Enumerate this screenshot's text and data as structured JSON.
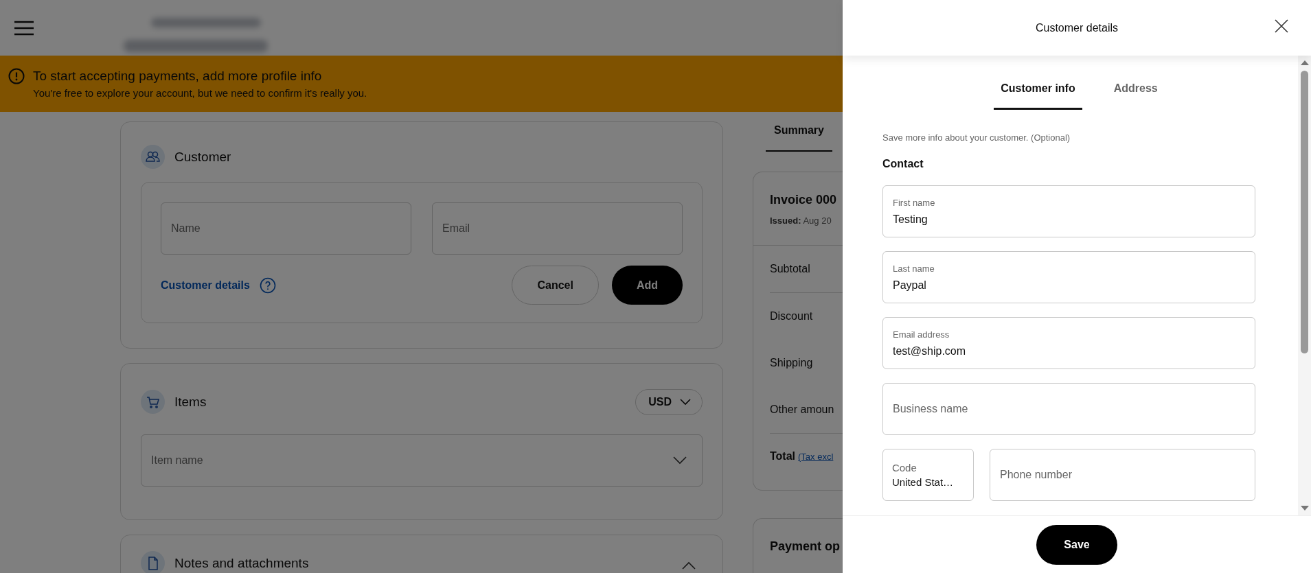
{
  "banner": {
    "title": "To start accepting payments, add more profile info",
    "message": "You're free to explore your account, but we need to confirm it's really you."
  },
  "customer_card": {
    "title": "Customer",
    "name_field": {
      "placeholder": "Name"
    },
    "email_field": {
      "placeholder": "Email"
    },
    "details_link": "Customer details",
    "buttons": [
      {
        "label": "Cancel",
        "kind": "secondary"
      },
      {
        "label": "Add",
        "kind": "primary"
      }
    ]
  },
  "items_card": {
    "title": "Items",
    "currency": "USD",
    "item_field": {
      "placeholder": "Item name"
    }
  },
  "notes_card": {
    "title": "Notes and attachments",
    "expanded": true
  },
  "summary": {
    "tab": {
      "label": "Summary",
      "selected": true
    },
    "invoice_title": "Invoice 000",
    "issued": "**Issued:** Aug 20",
    "rows": [
      "Subtotal",
      "Discount",
      "Shipping",
      "Other amoun"
    ],
    "total_label": "Total",
    "total_note": "(Tax excl"
  },
  "payment_card": {
    "title": "Payment op"
  },
  "drawer": {
    "title": "Customer details",
    "tabs": [
      {
        "label": "Customer info",
        "selected": true
      },
      {
        "label": "Address",
        "selected": false
      }
    ],
    "note": "Save more info about your customer. (Optional)",
    "section": "Contact",
    "fields": [
      {
        "label": "First name",
        "value": "Testing"
      },
      {
        "label": "Last name",
        "value": "Paypal"
      },
      {
        "label": "Email address",
        "value": "test@ship.com"
      },
      {
        "placeholder": "Business name"
      }
    ],
    "code": {
      "label": "Code",
      "value": "United Stat…"
    },
    "phone": {
      "placeholder": "Phone number"
    },
    "save": "Save"
  }
}
